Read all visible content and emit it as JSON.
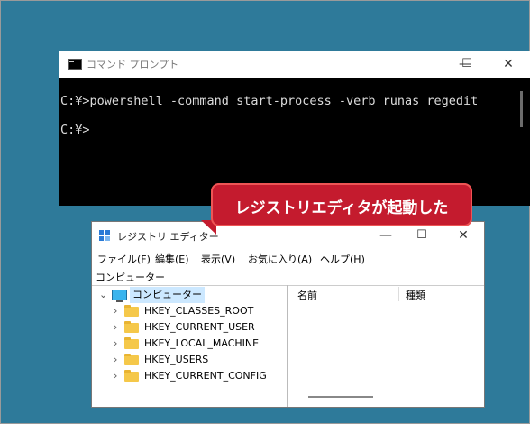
{
  "cmd_window": {
    "title": "コマンド プロンプト",
    "lines": [
      "C:¥>powershell -command start-process -verb runas regedit",
      "C:¥>"
    ],
    "controls": {
      "minimize": "—",
      "maximize": "☐",
      "close": "✕"
    }
  },
  "regedit_window": {
    "title": "レジストリ エディター",
    "controls": {
      "minimize": "—",
      "maximize": "☐",
      "close": "✕"
    },
    "menu": [
      "ファイル(F)",
      "編集(E)",
      "表示(V)",
      "お気に入り(A)",
      "ヘルプ(H)"
    ],
    "address": "コンピューター",
    "tree": {
      "root": "コンピューター",
      "keys": [
        "HKEY_CLASSES_ROOT",
        "HKEY_CURRENT_USER",
        "HKEY_LOCAL_MACHINE",
        "HKEY_USERS",
        "HKEY_CURRENT_CONFIG"
      ]
    },
    "columns": [
      "名前",
      "種類"
    ]
  },
  "callout": {
    "text": "レジストリエディタが起動した"
  },
  "colors": {
    "desktop": "#2e7a9a",
    "callout": "#c41b2e",
    "console_bg": "#000000",
    "folder": "#f5c84a"
  }
}
